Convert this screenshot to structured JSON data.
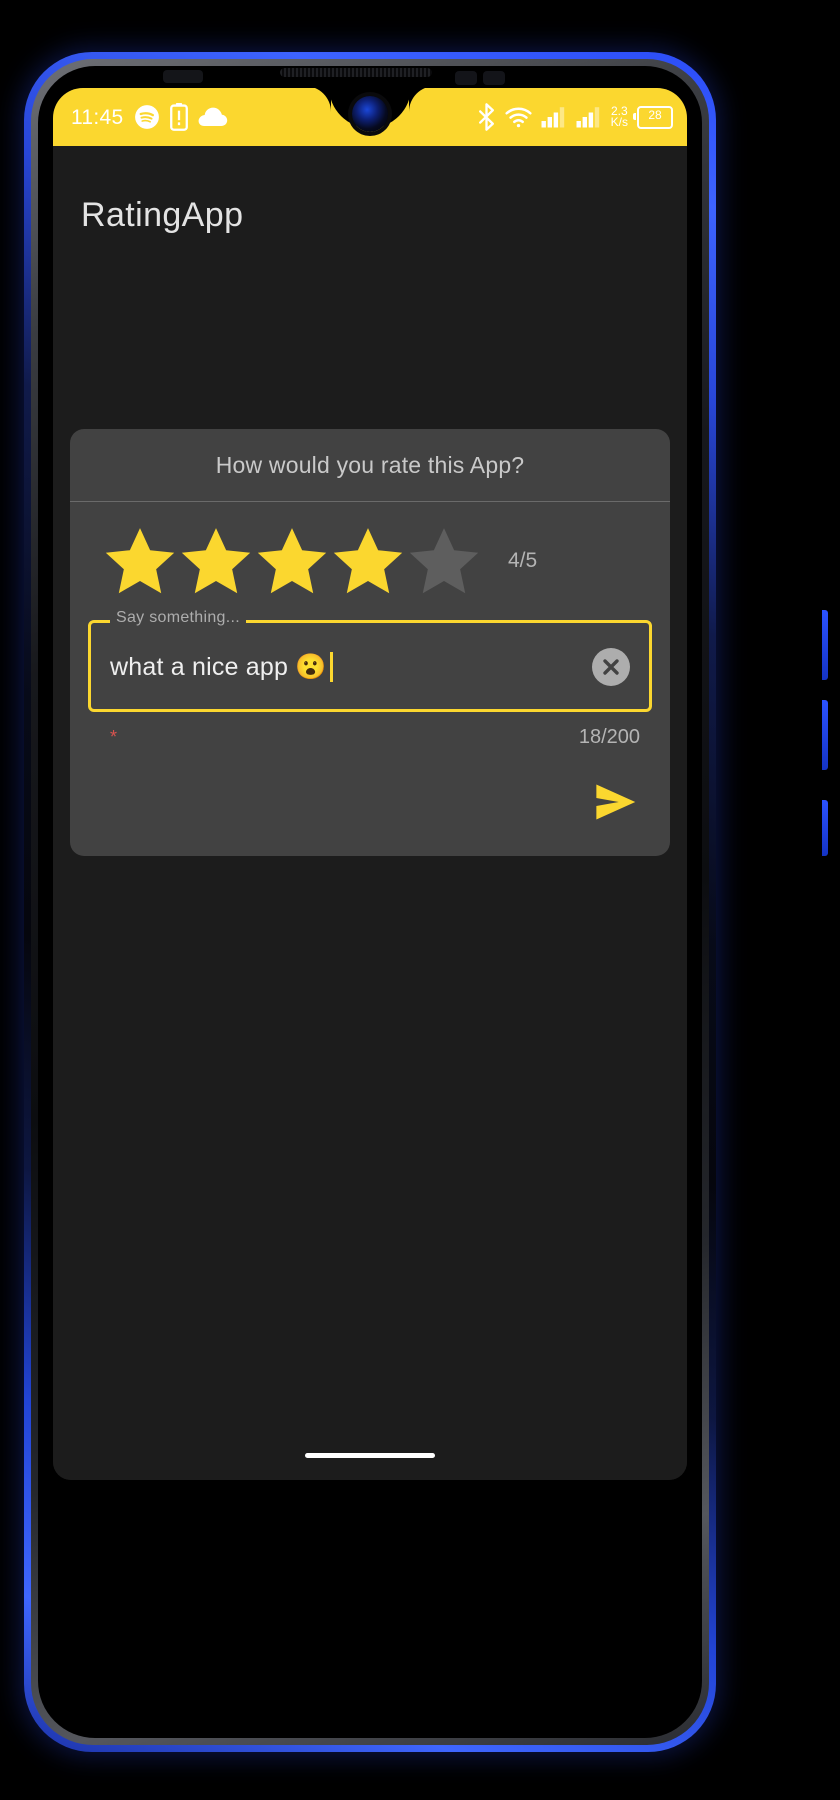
{
  "statusbar": {
    "time": "11:45",
    "left_icons": [
      "spotify-icon",
      "battery-alert-icon",
      "cloud-icon"
    ],
    "right_icons": [
      "bluetooth-icon",
      "wifi-icon",
      "signal-sim1-icon",
      "signal-sim2-icon"
    ],
    "net_speed_value": "2.3",
    "net_speed_unit": "K/s",
    "battery_percent": "28",
    "background_color": "#FBD72F",
    "icon_color": "#FFFFFF"
  },
  "app": {
    "title": "RatingApp",
    "background_color": "#1C1C1C",
    "accent_color": "#FBD72F"
  },
  "card": {
    "background_color": "#424242",
    "header_title": "How would you rate this App?",
    "rating": {
      "filled": 4,
      "total": 5,
      "value_label": "4/5",
      "filled_color": "#FBD72F",
      "empty_color": "#5E5E5E",
      "stars": [
        {
          "name": "star-1",
          "filled": true
        },
        {
          "name": "star-2",
          "filled": true
        },
        {
          "name": "star-3",
          "filled": true
        },
        {
          "name": "star-4",
          "filled": true
        },
        {
          "name": "star-5",
          "filled": false
        }
      ]
    },
    "comment_field": {
      "label": "Say something...",
      "value": "what a nice app 😮",
      "placeholder": "Say something...",
      "outline_color": "#FBD72F",
      "clear_icon": "close-circle-icon"
    },
    "helper": {
      "required_mark": "*",
      "required_color": "#D9534F",
      "char_counter": "18/200",
      "char_count": 18,
      "char_max": 200
    },
    "send": {
      "icon": "send-icon",
      "color": "#FBD72F"
    }
  },
  "device": {
    "frame_color": "#2B4CF7",
    "camera": "front-camera",
    "gesture_bar": "home-indicator"
  }
}
